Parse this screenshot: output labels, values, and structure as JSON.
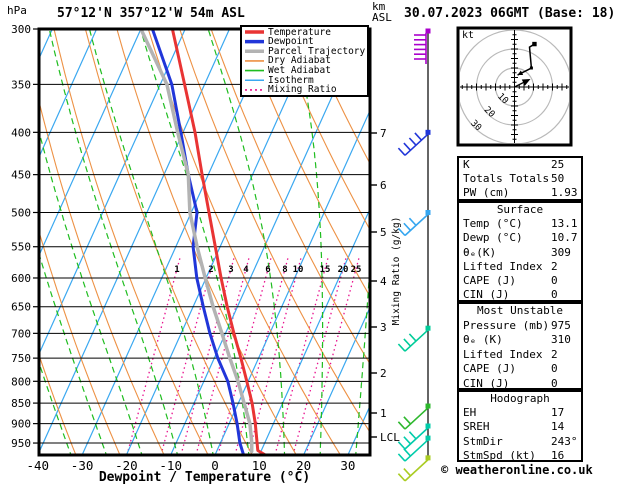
{
  "header": {
    "pressure_axis_unit": "hPa",
    "station_title": "57°12'N 357°12'W 54m ASL",
    "datetime_title": "30.07.2023 06GMT (Base: 18)",
    "altitude_axis_unit_line1": "km",
    "altitude_axis_unit_line2": "ASL"
  },
  "legend": {
    "items": [
      {
        "label": "Temperature",
        "color": "#e93434",
        "style": "thick-solid"
      },
      {
        "label": "Dewpoint",
        "color": "#2136d9",
        "style": "thick-solid"
      },
      {
        "label": "Parcel Trajectory",
        "color": "#b3b3b3",
        "style": "thick-solid"
      },
      {
        "label": "Dry Adiabat",
        "color": "#ed9144",
        "style": "thin-solid"
      },
      {
        "label": "Wet Adiabat",
        "color": "#1fbd1f",
        "style": "thin-solid"
      },
      {
        "label": "Isotherm",
        "color": "#3aa8f0",
        "style": "thin-solid"
      },
      {
        "label": "Mixing Ratio",
        "color": "#e8128e",
        "style": "dotted"
      }
    ]
  },
  "axes": {
    "pressure_ticks": [
      300,
      350,
      400,
      450,
      500,
      550,
      600,
      650,
      700,
      750,
      800,
      850,
      900,
      950
    ],
    "temperature_ticks": [
      -40,
      -30,
      -20,
      -10,
      0,
      10,
      20,
      30
    ],
    "x_axis_label": "Dewpoint / Temperature (°C)",
    "altitude_ticks_km": [
      7,
      6,
      5,
      4,
      3,
      2,
      1
    ],
    "lcl_label": "LCL",
    "mixing_ratio_axis_label": "Mixing Ratio (g/kg)",
    "mixing_ratio_values": [
      1,
      2,
      3,
      4,
      6,
      8,
      10,
      15,
      20,
      25
    ]
  },
  "chart_data": {
    "type": "skewt-logp-sounding",
    "pressure_range_hpa": [
      300,
      985
    ],
    "temperature_axis_range_c": [
      -40,
      35
    ],
    "series": [
      {
        "name": "Temperature",
        "color": "#e93434",
        "points_p_t": [
          [
            300,
            -52.9
          ],
          [
            350,
            -44.5
          ],
          [
            400,
            -37.3
          ],
          [
            450,
            -31.4
          ],
          [
            500,
            -26.0
          ],
          [
            550,
            -21.1
          ],
          [
            600,
            -16.6
          ],
          [
            650,
            -12.3
          ],
          [
            700,
            -8.1
          ],
          [
            750,
            -4.0
          ],
          [
            800,
            -0.3
          ],
          [
            850,
            3.1
          ],
          [
            900,
            5.9
          ],
          [
            950,
            8.3
          ],
          [
            970,
            9.2
          ],
          [
            983,
            11.5
          ]
        ]
      },
      {
        "name": "Dewpoint",
        "color": "#2136d9",
        "points_p_t": [
          [
            300,
            -57.4
          ],
          [
            350,
            -47.4
          ],
          [
            400,
            -40.5
          ],
          [
            450,
            -34.5
          ],
          [
            500,
            -28.7
          ],
          [
            550,
            -26.1
          ],
          [
            600,
            -22.1
          ],
          [
            650,
            -17.7
          ],
          [
            700,
            -13.5
          ],
          [
            750,
            -9.2
          ],
          [
            800,
            -4.6
          ],
          [
            850,
            -1.2
          ],
          [
            900,
            1.8
          ],
          [
            950,
            4.4
          ],
          [
            983,
            6.5
          ]
        ]
      },
      {
        "name": "Parcel Trajectory",
        "color": "#b3b3b3",
        "points_p_t": [
          [
            300,
            -60.0
          ],
          [
            350,
            -48.5
          ],
          [
            400,
            -41.2
          ],
          [
            450,
            -34.5
          ],
          [
            500,
            -30.3
          ],
          [
            550,
            -25.2
          ],
          [
            600,
            -20.2
          ],
          [
            650,
            -15.5
          ],
          [
            700,
            -10.8
          ],
          [
            750,
            -6.5
          ],
          [
            800,
            -2.3
          ],
          [
            850,
            1.3
          ],
          [
            900,
            4.7
          ],
          [
            950,
            7.1
          ],
          [
            972,
            7.9
          ]
        ]
      }
    ],
    "wind_barbs": [
      {
        "pressure": 301,
        "color": "#aa00cc",
        "style": "flag-stack",
        "ticks": 6
      },
      {
        "pressure": 400,
        "color": "#2136d9",
        "style": "barb",
        "ticks": 4
      },
      {
        "pressure": 500,
        "color": "#35a6f0",
        "style": "barb",
        "ticks": 3
      },
      {
        "pressure": 690,
        "color": "#00cc99",
        "style": "barb",
        "ticks": 3
      },
      {
        "pressure": 857,
        "color": "#2db82d",
        "style": "barb",
        "ticks": 2
      },
      {
        "pressure": 906,
        "color": "#00ccaa",
        "style": "barb",
        "ticks": 3
      },
      {
        "pressure": 937,
        "color": "#00ccaa",
        "style": "barb",
        "ticks": 2
      },
      {
        "pressure": 990,
        "color": "#aacc22",
        "style": "barb",
        "ticks": 2
      }
    ],
    "hodograph": {
      "unit": "kt",
      "ring_radii_kt": [
        10,
        20,
        30
      ],
      "trace_uv_kt": [
        [
          1.6,
          6.3
        ],
        [
          8.9,
          10.0
        ],
        [
          7.9,
          21.0
        ],
        [
          10.5,
          22.6
        ]
      ],
      "storm_motion_uv_kt": [
        8.4,
        4.2
      ]
    }
  },
  "tables": {
    "indices": {
      "rows": [
        [
          "K",
          "25"
        ],
        [
          "Totals Totals",
          "50"
        ],
        [
          "PW (cm)",
          "1.93"
        ]
      ]
    },
    "surface": {
      "header": "Surface",
      "rows": [
        [
          "Temp (°C)",
          "13.1"
        ],
        [
          "Dewp (°C)",
          "10.7"
        ],
        [
          "θₑ(K)",
          "309"
        ],
        [
          "Lifted Index",
          "2"
        ],
        [
          "CAPE (J)",
          "0"
        ],
        [
          "CIN (J)",
          "0"
        ]
      ]
    },
    "most_unstable": {
      "header": "Most Unstable",
      "rows": [
        [
          "Pressure (mb)",
          "975"
        ],
        [
          "θₑ (K)",
          "310"
        ],
        [
          "Lifted Index",
          "2"
        ],
        [
          "CAPE (J)",
          "0"
        ],
        [
          "CIN (J)",
          "0"
        ]
      ]
    },
    "hodograph": {
      "header": "Hodograph",
      "rows": [
        [
          "EH",
          "17"
        ],
        [
          "SREH",
          "14"
        ],
        [
          "StmDir",
          "243°"
        ],
        [
          "StmSpd (kt)",
          "16"
        ]
      ]
    }
  },
  "footer": {
    "copyright": "© weatheronline.co.uk"
  }
}
